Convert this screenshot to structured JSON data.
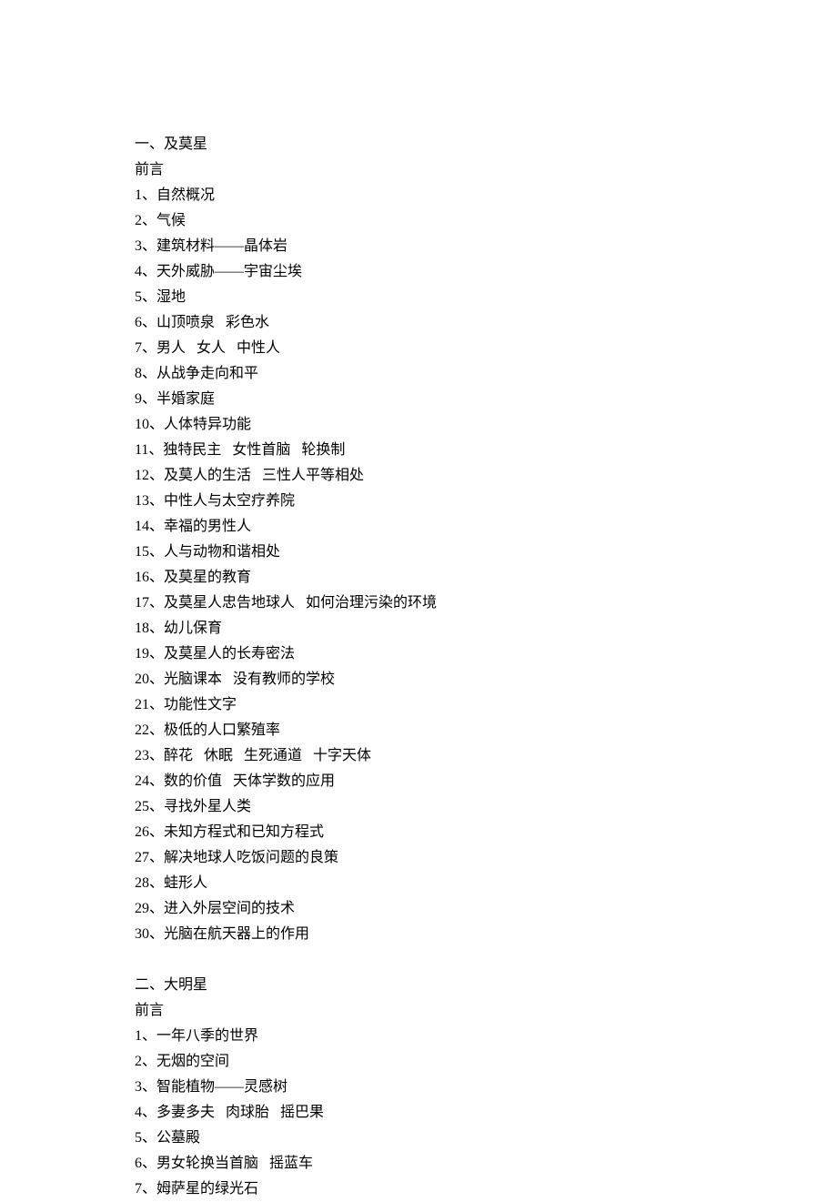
{
  "sections": [
    {
      "title": "一、及莫星",
      "preface": "前言",
      "items": [
        "1、自然概况",
        "2、气候",
        "3、建筑材料——晶体岩",
        "4、天外威胁——宇宙尘埃",
        "5、湿地",
        "6、山顶喷泉   彩色水",
        "7、男人   女人   中性人",
        "8、从战争走向和平",
        "9、半婚家庭",
        "10、人体特异功能",
        "11、独特民主   女性首脑   轮换制",
        "12、及莫人的生活   三性人平等相处",
        "13、中性人与太空疗养院",
        "14、幸福的男性人",
        "15、人与动物和谐相处",
        "16、及莫星的教育",
        "17、及莫星人忠告地球人   如何治理污染的环境",
        "18、幼儿保育",
        "19、及莫星人的长寿密法",
        "20、光脑课本   没有教师的学校",
        "21、功能性文字",
        "22、极低的人口繁殖率",
        "23、醉花   休眠   生死通道   十字天体",
        "24、数的价值   天体学数的应用",
        "25、寻找外星人类",
        "26、未知方程式和已知方程式",
        "27、解决地球人吃饭问题的良策",
        "28、蛙形人",
        "29、进入外层空间的技术",
        "30、光脑在航天器上的作用"
      ]
    },
    {
      "title": "二、大明星",
      "preface": "前言",
      "items": [
        "1、一年八季的世界",
        "2、无烟的空间",
        "3、智能植物——灵感树",
        "4、多妻多夫   肉球胎   摇巴果",
        "5、公墓殿",
        "6、男女轮换当首脑   摇蓝车",
        "7、姆萨星的绿光石"
      ]
    }
  ]
}
